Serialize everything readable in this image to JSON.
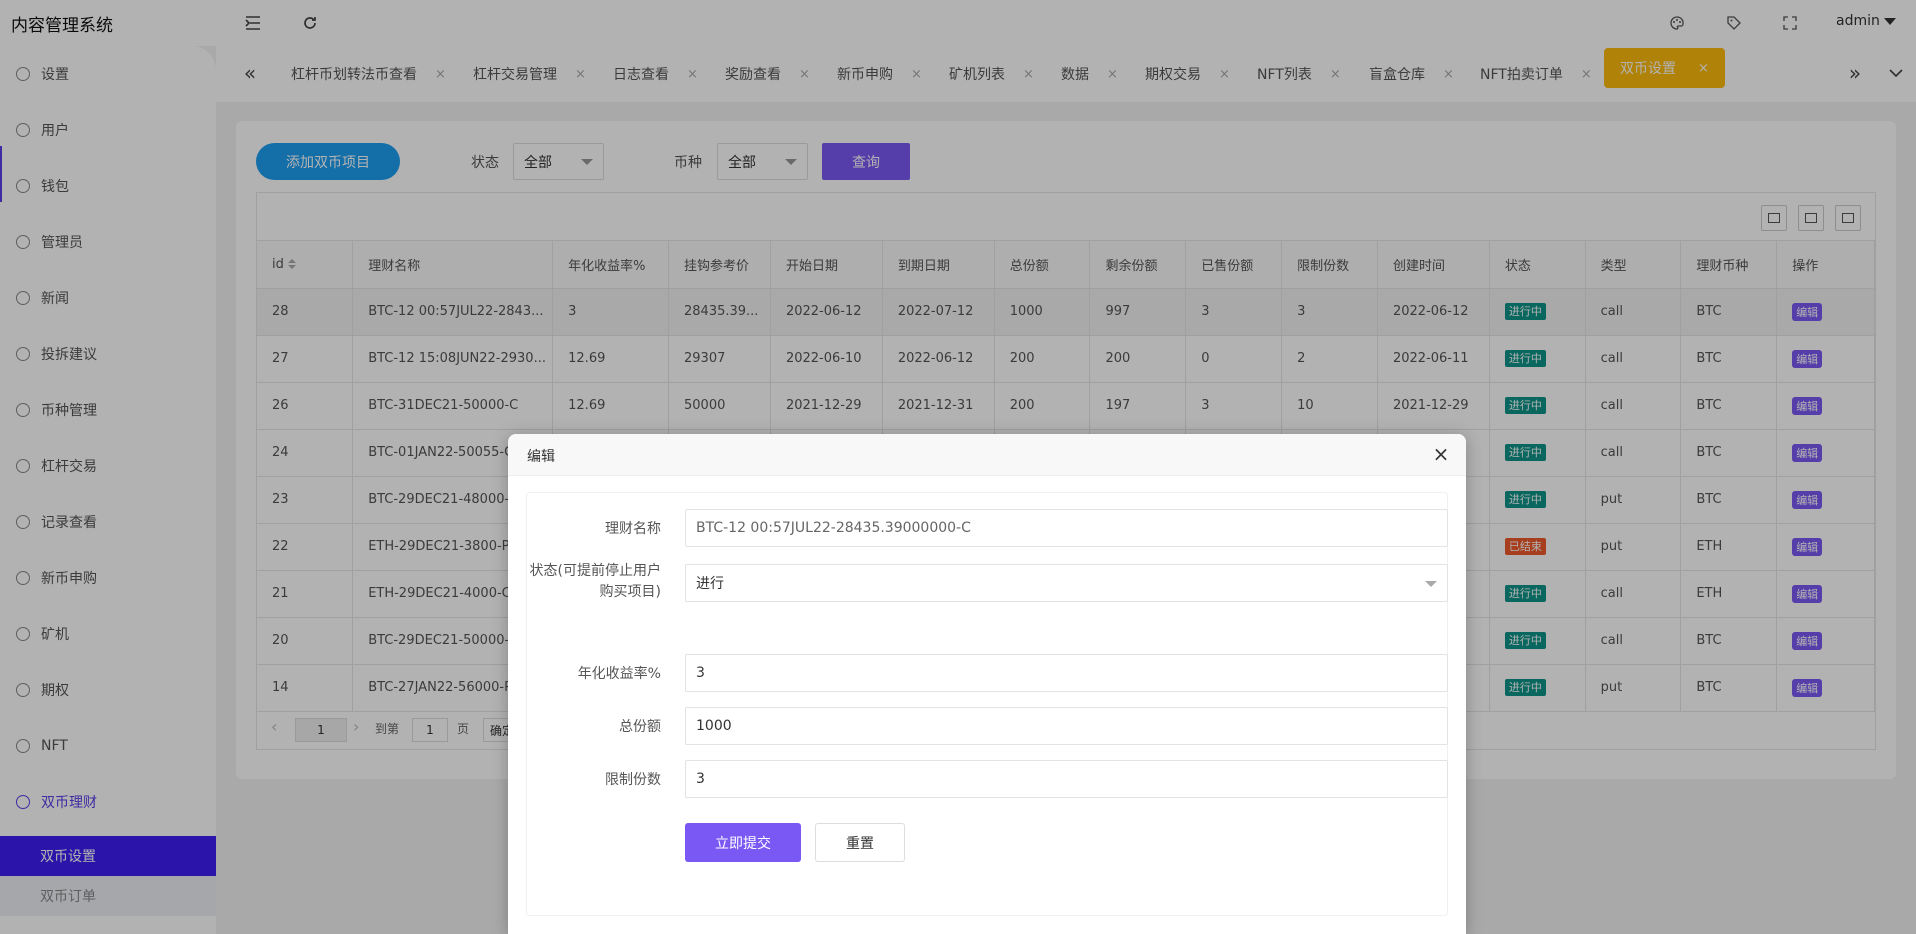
{
  "app": {
    "title": "内容管理系统",
    "user": "admin"
  },
  "sidebar": {
    "items": [
      {
        "label": "设置",
        "icon": "gear-icon"
      },
      {
        "label": "用户",
        "icon": "user-icon"
      },
      {
        "label": "钱包",
        "icon": "wallet-icon"
      },
      {
        "label": "管理员",
        "icon": "shield-icon"
      },
      {
        "label": "新闻",
        "icon": "tag-icon"
      },
      {
        "label": "投拆建议",
        "icon": "infinity-icon"
      },
      {
        "label": "币种管理",
        "icon": "diamond-icon"
      },
      {
        "label": "杠杆交易",
        "icon": "diamond-icon"
      },
      {
        "label": "记录查看",
        "icon": "circle-arrow-icon"
      },
      {
        "label": "新币申购",
        "icon": "coin-icon"
      },
      {
        "label": "矿机",
        "icon": "circle-arrow-icon"
      },
      {
        "label": "期权",
        "icon": "circle-arrow-icon"
      },
      {
        "label": "NFT",
        "icon": "circle-arrow-icon"
      },
      {
        "label": "双币理财",
        "icon": "circle-arrow-icon"
      }
    ],
    "subitems": [
      {
        "label": "双币设置"
      },
      {
        "label": "双币订单"
      }
    ]
  },
  "tabs": {
    "items": [
      "杠杆币划转法币查看",
      "杠杆交易管理",
      "日志查看",
      "奖励查看",
      "新币申购",
      "矿机列表",
      "数据",
      "期权交易",
      "NFT列表",
      "盲盒仓库",
      "NFT拍卖订单",
      "双币设置"
    ],
    "close": "×"
  },
  "filters": {
    "add_label": "添加双币项目",
    "status_label": "状态",
    "status_value": "全部",
    "coin_label": "币种",
    "coin_value": "全部",
    "query_label": "查询"
  },
  "table": {
    "columns": [
      "id",
      "理财名称",
      "年化收益率%",
      "挂钩参考价",
      "开始日期",
      "到期日期",
      "总份额",
      "剩余份额",
      "已售份额",
      "限制份数",
      "创建时间",
      "状态",
      "类型",
      "理财币种",
      "操作"
    ],
    "rows": [
      [
        "28",
        "BTC-12 00:57JUL22-2843...",
        "3",
        "28435.39...",
        "2022-06-12",
        "2022-07-12",
        "1000",
        "997",
        "3",
        "3",
        "2022-06-12",
        "进行中",
        "call",
        "BTC",
        "编辑"
      ],
      [
        "27",
        "BTC-12 15:08JUN22-2930...",
        "12.69",
        "29307",
        "2022-06-10",
        "2022-06-12",
        "200",
        "200",
        "0",
        "2",
        "2022-06-11",
        "进行中",
        "call",
        "BTC",
        "编辑"
      ],
      [
        "26",
        "BTC-31DEC21-50000-C",
        "12.69",
        "50000",
        "2021-12-29",
        "2021-12-31",
        "200",
        "197",
        "3",
        "10",
        "2021-12-29",
        "进行中",
        "call",
        "BTC",
        "编辑"
      ],
      [
        "24",
        "BTC-01JAN22-50055-C",
        "",
        "",
        "",
        "",
        "",
        "",
        "",
        "",
        "",
        "进行中",
        "call",
        "BTC",
        "编辑"
      ],
      [
        "23",
        "BTC-29DEC21-48000-P",
        "",
        "",
        "",
        "",
        "",
        "",
        "",
        "",
        "",
        "进行中",
        "put",
        "BTC",
        "编辑"
      ],
      [
        "22",
        "ETH-29DEC21-3800-P",
        "",
        "",
        "",
        "",
        "",
        "",
        "",
        "",
        "",
        "已结束",
        "put",
        "ETH",
        "编辑"
      ],
      [
        "21",
        "ETH-29DEC21-4000-C",
        "",
        "",
        "",
        "",
        "",
        "",
        "",
        "",
        "",
        "进行中",
        "call",
        "ETH",
        "编辑"
      ],
      [
        "20",
        "BTC-29DEC21-50000-C",
        "",
        "",
        "",
        "",
        "",
        "",
        "",
        "",
        "",
        "进行中",
        "call",
        "BTC",
        "编辑"
      ],
      [
        "14",
        "BTC-27JAN22-56000-P",
        "",
        "",
        "",
        "",
        "",
        "",
        "",
        "",
        "",
        "进行中",
        "put",
        "BTC",
        "编辑"
      ]
    ]
  },
  "pager": {
    "current": "1",
    "goto_label": "到第",
    "goto_value": "1",
    "page_unit": "页",
    "confirm": "确定"
  },
  "modal": {
    "title": "编辑",
    "fields": [
      {
        "label": "理财名称",
        "value": "BTC-12 00:57JUL22-28435.39000000-C"
      },
      {
        "label": "状态(可提前停止用户购买项目)",
        "value": "进行"
      },
      {
        "label": "年化收益率%",
        "value": "3"
      },
      {
        "label": "总份额",
        "value": "1000"
      },
      {
        "label": "限制份数",
        "value": "3"
      }
    ],
    "submit_label": "立即提交",
    "reset_label": "重置"
  },
  "colors": {
    "accent": "#7a58f4",
    "tab_active": "#fdbb0b",
    "add_button": "#1e9ff2",
    "running": "#0d9488",
    "ended": "#ef5b2b",
    "sidebar_active": "#3e1ef2"
  }
}
